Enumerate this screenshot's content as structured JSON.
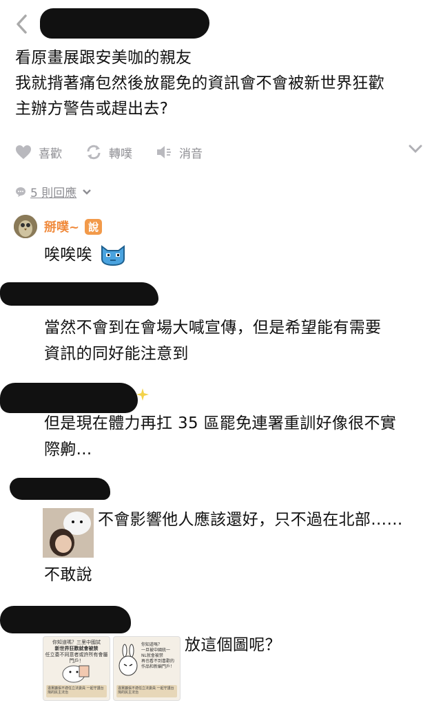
{
  "post": {
    "lines": [
      "看原畫展跟安美咖的親友",
      "我就揹著痛包然後放罷免的資訊會不會被新世界狂歡",
      "主辦方警告或趕出去?"
    ]
  },
  "actions": {
    "like": "喜歡",
    "replurk": "轉噗",
    "mute": "消音"
  },
  "replies_label": "5 則回應",
  "comments": [
    {
      "nickname": "掰噗~",
      "badge": "說",
      "lines": [
        "唉唉唉"
      ],
      "avatar_icon": "owl-avatar-icon",
      "sticker_icon": "blue-cat-emoji-icon"
    },
    {
      "lines": [
        "當然不會到在會場大喊宣傳，但是希望能有需要",
        "資訊的同好能注意到"
      ]
    },
    {
      "lines": [
        "但是現在體力再扛 35 區罷免連署重訓好像很不實",
        "際齁..."
      ]
    },
    {
      "lines": [
        "不會影響他人應該還好，只不過在北部……",
        "不敢說"
      ]
    },
    {
      "lines": [
        "放這個圖呢？"
      ]
    }
  ],
  "images": {
    "card1_top": [
      "你知道嗎？三里中國試",
      "新世界狂歡就會被禁",
      "任立委不同意者或許所有會屬門戶！"
    ],
    "card1_bottom": "違憲擴張不適任立法委員 一起守護台灣的民主法治",
    "card2_top": [
      "你知道嗎？",
      "一旦被中國統一",
      "NL就會被禁",
      "再也看不到喜歡的",
      "作品和新編門戶！"
    ],
    "card2_bottom": "違憲擴張不適任立法委員 一起守護台灣的民主法治"
  },
  "colors": {
    "accent": "#f08a3c",
    "muted": "#8e8e93",
    "link": "#8e8e93"
  }
}
